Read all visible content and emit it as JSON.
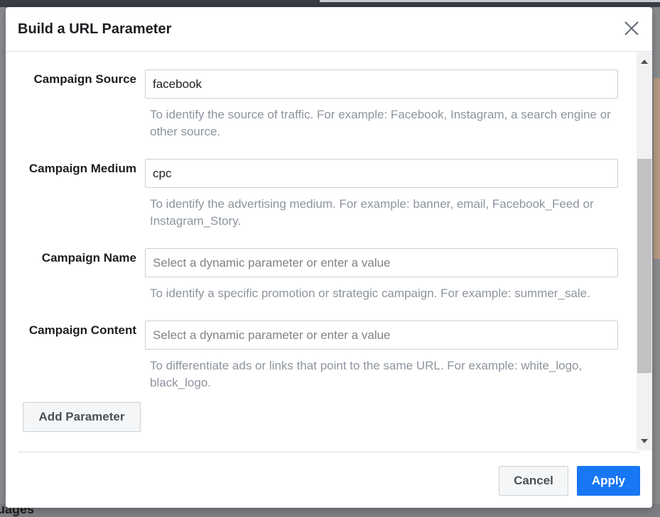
{
  "dialog": {
    "title": "Build a URL Parameter",
    "close_icon": "close-icon"
  },
  "params": [
    {
      "label": "Campaign Source",
      "value": "facebook",
      "placeholder": "Select a dynamic parameter or enter a value",
      "help": "To identify the source of traffic. For example: Facebook, Instagram, a search engine or other source."
    },
    {
      "label": "Campaign Medium",
      "value": "cpc",
      "placeholder": "Select a dynamic parameter or enter a value",
      "help": "To identify the advertising medium. For example: banner, email, Facebook_Feed or Instagram_Story."
    },
    {
      "label": "Campaign Name",
      "value": "",
      "placeholder": "Select a dynamic parameter or enter a value",
      "help": "To identify a specific promotion or strategic campaign. For example: summer_sale."
    },
    {
      "label": "Campaign Content",
      "value": "",
      "placeholder": "Select a dynamic parameter or enter a value",
      "help": "To differentiate ads or links that point to the same URL. For example: white_logo, black_logo."
    }
  ],
  "add_parameter_label": "Add Parameter",
  "footer": {
    "cancel_label": "Cancel",
    "apply_label": "Apply"
  },
  "background": {
    "bottom_text": "uages"
  },
  "colors": {
    "primary": "#1877f2",
    "text": "#1c1e21",
    "help_text": "#8d949e",
    "border": "#ccd0d5"
  }
}
